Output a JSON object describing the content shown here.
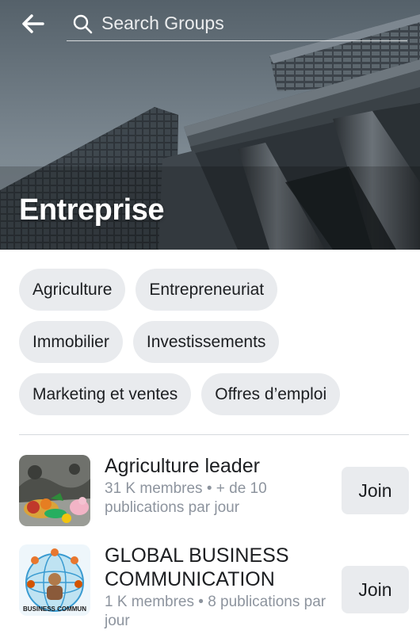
{
  "header": {
    "search_placeholder": "Search Groups",
    "back_icon": "arrow-left-icon",
    "search_icon": "search-icon"
  },
  "hero": {
    "title": "Entreprise"
  },
  "categories": [
    "Agriculture",
    "Entrepreneuriat",
    "Immobilier",
    "Investissements",
    "Marketing et ventes",
    "Offres d’emploi"
  ],
  "groups": [
    {
      "name": "Agriculture leader",
      "meta": "31 K membres • + de 10 publications par jour",
      "join_label": "Join"
    },
    {
      "name": "GLOBAL BUSINESS COMMUNICATION",
      "meta": "1 K membres • 8 publications par jour",
      "join_label": "Join",
      "thumb_text": "BUSINESS COMMUN"
    }
  ],
  "colors": {
    "chip_bg": "#e9ebee",
    "text": "#1c1e21",
    "secondary_text": "#8d949e"
  }
}
